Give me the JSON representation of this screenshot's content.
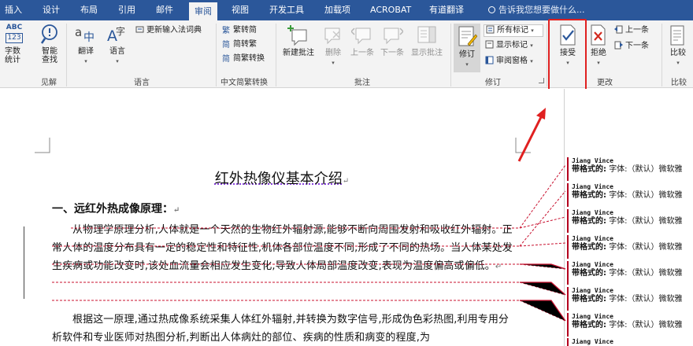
{
  "tabs": [
    {
      "label": "插入",
      "active": false
    },
    {
      "label": "设计",
      "active": false
    },
    {
      "label": "布局",
      "active": false
    },
    {
      "label": "引用",
      "active": false
    },
    {
      "label": "邮件",
      "active": false
    },
    {
      "label": "审阅",
      "active": true
    },
    {
      "label": "视图",
      "active": false
    },
    {
      "label": "开发工具",
      "active": false
    },
    {
      "label": "加载项",
      "active": false
    },
    {
      "label": "ACROBAT",
      "active": false
    },
    {
      "label": "有道翻译",
      "active": false
    }
  ],
  "tell_me": "告诉我您想要做什么...",
  "ribbon": {
    "proofing": {
      "word_count_top": "ABC",
      "word_count_num": "123",
      "word_count": "字数统计",
      "smart_lookup": "智能查找",
      "group": "见解"
    },
    "language": {
      "translate": "翻译",
      "language": "语言",
      "update_ime": "更新输入法词典",
      "group": "语言"
    },
    "chinese": {
      "to_traditional": "繁转简",
      "to_simplified": "简转繁",
      "convert": "简繁转换",
      "group": "中文简繁转换"
    },
    "comments": {
      "new": "新建批注",
      "delete": "删除",
      "previous": "上一条",
      "next": "下一条",
      "show": "显示批注",
      "group": "批注"
    },
    "tracking": {
      "track_changes": "修订",
      "all_markup": "所有标记",
      "show_markup": "显示标记",
      "reviewing_pane": "审阅窗格",
      "group": "修订"
    },
    "changes": {
      "accept": "接受",
      "reject": "拒绝",
      "previous": "上一条",
      "next": "下一条",
      "group": "更改"
    },
    "compare": {
      "compare": "比较",
      "group": "比较"
    }
  },
  "document": {
    "title": "红外热像仪基本介绍",
    "heading1": "一、远红外热成像原理：",
    "para1": "从物理学原理分析,人体就是一个天然的生物红外辐射源,能够不断向周围发射和吸收红外辐射。正常人体的温度分布具有一定的稳定性和特征性,机体各部位温度不同,形成了不同的热场。当人体某处发生疾病或功能改变时,该处血流量会相应发生变化,导致人体局部温度改变,表现为温度偏高或偏低。",
    "para2": "根据这一原理,通过热成像系统采集人体红外辐射,并转换为数字信号,形成伪色彩热图,利用专用分析软件和专业医师对热图分析,判断出人体病灶的部位、疾病的性质和病变的程度,为"
  },
  "comments": [
    {
      "author": "Jiang Vince",
      "label": "带格式的:",
      "text": "字体:（默认）微软雅"
    },
    {
      "author": "Jiang Vince",
      "label": "带格式的:",
      "text": "字体:（默认）微软雅"
    },
    {
      "author": "Jiang Vince",
      "label": "带格式的:",
      "text": "字体:（默认）微软雅"
    },
    {
      "author": "Jiang Vince",
      "label": "带格式的:",
      "text": "字体:（默认）微软雅"
    },
    {
      "author": "Jiang Vince",
      "label": "带格式的:",
      "text": "字体:（默认）微软雅"
    },
    {
      "author": "Jiang Vince",
      "label": "带格式的:",
      "text": "字体:（默认）微软雅"
    },
    {
      "author": "Jiang Vince",
      "label": "带格式的:",
      "text": "字体:（默认）微软雅"
    },
    {
      "author": "Jiang Vince",
      "label": "",
      "text": ""
    }
  ],
  "colors": {
    "tab_bar": "#2b579a",
    "ribbon": "#f3f3f3",
    "highlight": "#e02020",
    "revision": "#b4001e"
  }
}
